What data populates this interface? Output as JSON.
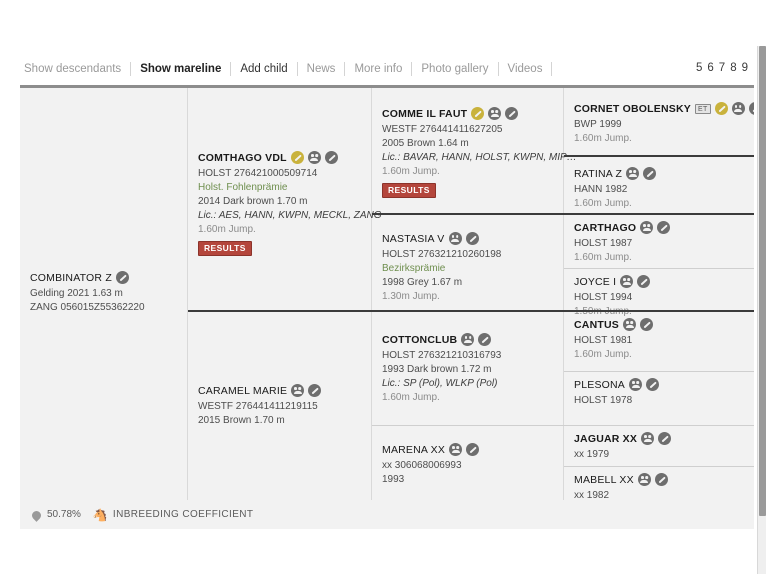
{
  "nav": {
    "items": [
      {
        "label": "Show descendants",
        "style": "muted"
      },
      {
        "label": "Show mareline",
        "style": "bold"
      },
      {
        "label": "Add child",
        "style": "dark"
      },
      {
        "label": "News",
        "style": "muted"
      },
      {
        "label": "More info",
        "style": "muted"
      },
      {
        "label": "Photo gallery",
        "style": "muted"
      },
      {
        "label": "Videos",
        "style": "muted"
      }
    ],
    "generations": [
      "5",
      "6",
      "7",
      "8",
      "9"
    ]
  },
  "pedigree": {
    "subject": {
      "name": "COMBINATOR Z",
      "icons": [
        "edit-pencil-icon"
      ],
      "lines": [
        "Gelding 2021 1.63 m",
        "ZANG 056015Z55362220"
      ]
    },
    "gen1": [
      {
        "name": "COMTHAGO VDL",
        "bold": true,
        "icons": [
          "gold-pencil-icon",
          "pedigree-icon",
          "edit-pencil-icon"
        ],
        "reg": "HOLST 276421000509714",
        "award": "Holst. Fohlenprämie",
        "desc": "2014 Dark brown 1.70 m",
        "lic": "Lic.: AES, HANN, KWPN, MECKL, ZANG",
        "jump": "1.60m Jump.",
        "badge": "RESULTS"
      },
      {
        "name": "CARAMEL MARIE",
        "bold": false,
        "icons": [
          "pedigree-icon",
          "edit-pencil-icon"
        ],
        "reg": "WESTF 276441411219115",
        "desc": "2015 Brown 1.70 m"
      }
    ],
    "gen2": [
      {
        "name": "COMME IL FAUT",
        "bold": true,
        "icons": [
          "gold-pencil-icon",
          "pedigree-icon",
          "edit-pencil-icon"
        ],
        "reg": "WESTF 276441411627205",
        "desc": "2005 Brown 1.64 m",
        "lic": "Lic.: BAVAR, HANN, HOLST, KWPN, MIP…",
        "jump": "1.60m Jump.",
        "badge": "RESULTS"
      },
      {
        "name": "NASTASIA V",
        "bold": false,
        "icons": [
          "pedigree-icon",
          "edit-pencil-icon"
        ],
        "reg": "HOLST 276321210260198",
        "award": "Bezirksprämie",
        "desc": "1998 Grey 1.67 m",
        "jump": "1.30m Jump."
      },
      {
        "name": "COTTONCLUB",
        "bold": true,
        "icons": [
          "pedigree-icon",
          "edit-pencil-icon"
        ],
        "reg": "HOLST 276321210316793",
        "desc": "1993 Dark brown 1.72 m",
        "lic": "Lic.: SP (Pol), WLKP (Pol)",
        "jump": "1.60m Jump."
      },
      {
        "name": "MARENA XX",
        "bold": false,
        "icons": [
          "pedigree-icon",
          "edit-pencil-icon"
        ],
        "reg": "xx 306068006993",
        "desc": "1993"
      }
    ],
    "gen3": [
      {
        "name": "CORNET OBOLENSKY",
        "bold": true,
        "icons": [
          "et-badge",
          "gold-pencil-icon",
          "pedigree-icon",
          "edit-pencil-icon"
        ],
        "reg": "BWP 1999",
        "jump": "1.60m Jump."
      },
      {
        "name": "RATINA Z",
        "bold": false,
        "icons": [
          "pedigree-icon",
          "edit-pencil-icon"
        ],
        "reg": "HANN 1982",
        "jump": "1.60m Jump."
      },
      {
        "name": "CARTHAGO",
        "bold": true,
        "icons": [
          "pedigree-icon",
          "edit-pencil-icon"
        ],
        "reg": "HOLST 1987",
        "jump": "1.60m Jump."
      },
      {
        "name": "JOYCE I",
        "bold": false,
        "icons": [
          "pedigree-icon",
          "edit-pencil-icon"
        ],
        "reg": "HOLST 1994",
        "jump": "1.50m Jump."
      },
      {
        "name": "CANTUS",
        "bold": true,
        "icons": [
          "pedigree-icon",
          "edit-pencil-icon"
        ],
        "reg": "HOLST 1981",
        "jump": "1.60m Jump."
      },
      {
        "name": "PLESONA",
        "bold": false,
        "icons": [
          "pedigree-icon",
          "edit-pencil-icon"
        ],
        "reg": "HOLST 1978"
      },
      {
        "name": "JAGUAR XX",
        "bold": true,
        "icons": [
          "pedigree-icon",
          "edit-pencil-icon"
        ],
        "reg": "xx 1979"
      },
      {
        "name": "MABELL XX",
        "bold": false,
        "icons": [
          "pedigree-icon",
          "edit-pencil-icon"
        ],
        "reg": "xx 1982"
      }
    ]
  },
  "footer": {
    "value": "50.78%",
    "label": "INBREEDING COEFFICIENT"
  }
}
